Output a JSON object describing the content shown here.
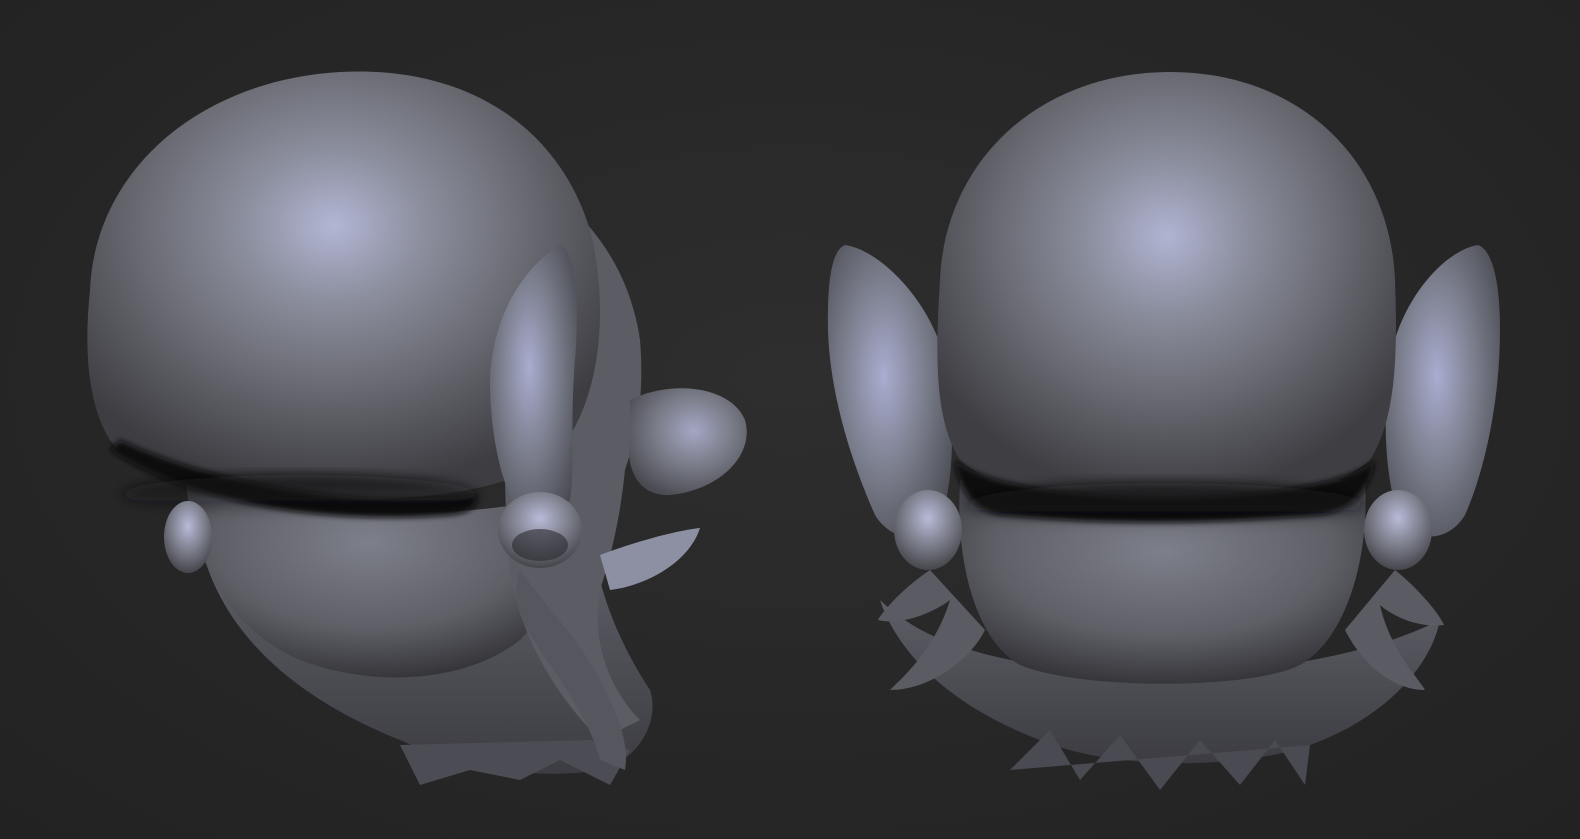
{
  "scene": {
    "background_color": "#262626",
    "material_base_color": "#6e6f78",
    "material_highlight_color": "#b4b8d8",
    "material_shadow_color": "#0e0e10"
  },
  "views": [
    {
      "name": "three-quarter-back-view"
    },
    {
      "name": "back-view"
    }
  ]
}
